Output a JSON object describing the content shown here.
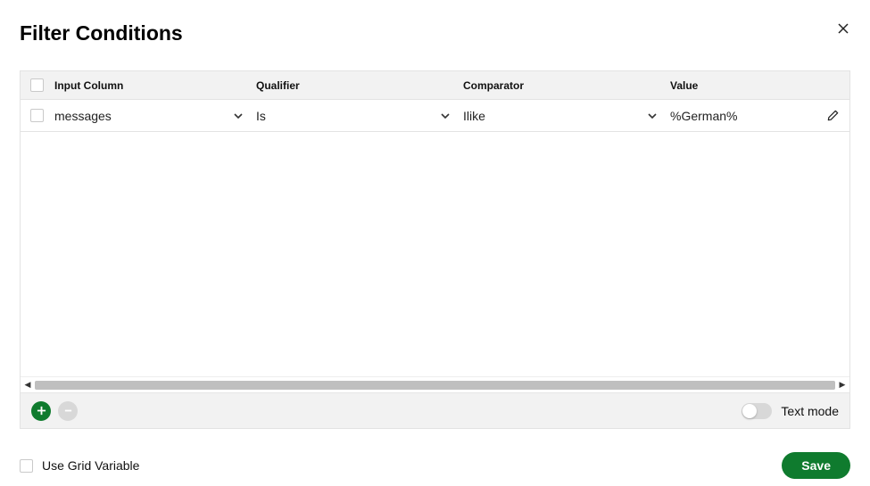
{
  "title": "Filter Conditions",
  "columns": {
    "input": "Input Column",
    "qualifier": "Qualifier",
    "comparator": "Comparator",
    "value": "Value"
  },
  "rows": [
    {
      "input": "messages",
      "qualifier": "Is",
      "comparator": "Ilike",
      "value": "%German%"
    }
  ],
  "toolbar": {
    "text_mode_label": "Text mode"
  },
  "footer": {
    "use_grid_variable_label": "Use Grid Variable",
    "save_label": "Save"
  }
}
